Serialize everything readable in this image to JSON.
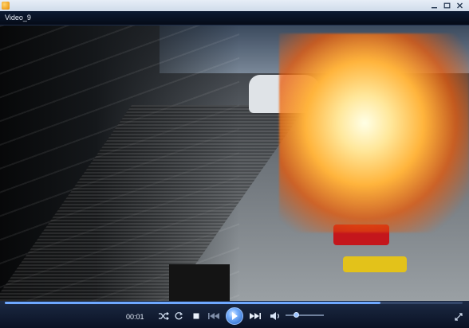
{
  "window": {
    "title": "Video_9",
    "controls": [
      {
        "name": "minimize-icon",
        "glyph": "—"
      },
      {
        "name": "maximize-icon",
        "glyph": "□"
      },
      {
        "name": "close-icon",
        "glyph": "×"
      }
    ]
  },
  "player": {
    "elapsed_time": "00:01",
    "seek_progress": 0.82,
    "volume_level": 0.28
  },
  "colors": {
    "accent": "#6ea8ff",
    "background": "#0a1224",
    "titlebar": "#cfdbea"
  }
}
